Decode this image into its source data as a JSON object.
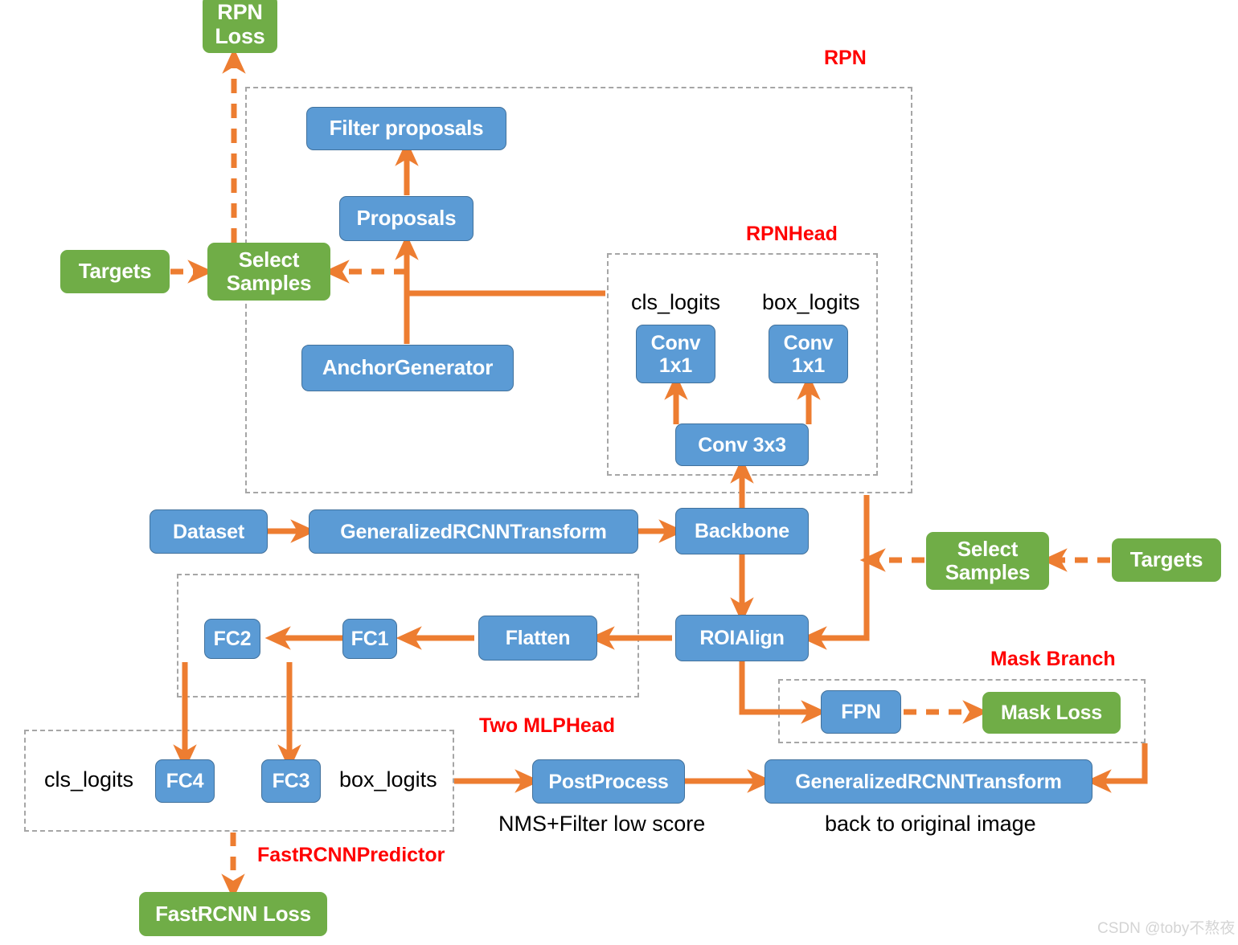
{
  "colors": {
    "blue_fill": "#5b9bd5",
    "blue_stroke": "#41719c",
    "green_fill": "#70ad47",
    "arrow_orange": "#ed7d31",
    "dash_gray": "#a6a6a6",
    "label_red": "#ff0000",
    "watermark_gray": "#d4d4d4"
  },
  "diagram": {
    "title": "Mask R-CNN / Faster R-CNN pipeline",
    "groups": [
      {
        "name": "RPN",
        "label": "RPN"
      },
      {
        "name": "RPNHead",
        "label": "RPNHead"
      },
      {
        "name": "TwoMLPHead",
        "label": "Two MLPHead"
      },
      {
        "name": "FastRCNNPredictor",
        "label": "FastRCNNPredictor"
      },
      {
        "name": "MaskBranch",
        "label": "Mask Branch"
      }
    ],
    "nodes": {
      "rpn_loss": "RPN\nLoss",
      "targets_left": "Targets",
      "select_samples_left": "Select\nSamples",
      "filter_proposals": "Filter proposals",
      "proposals": "Proposals",
      "anchor_generator": "AnchorGenerator",
      "conv1x1_cls": "Conv\n1x1",
      "conv1x1_box": "Conv\n1x1",
      "conv3x3": "Conv 3x3",
      "dataset": "Dataset",
      "transform_in": "GeneralizedRCNNTransform",
      "backbone": "Backbone",
      "select_samples_right": "Select\nSamples",
      "targets_right": "Targets",
      "roialign": "ROIAlign",
      "flatten": "Flatten",
      "fc1": "FC1",
      "fc2": "FC2",
      "fc4": "FC4",
      "fc3": "FC3",
      "fpn": "FPN",
      "mask_loss": "Mask Loss",
      "postprocess": "PostProcess",
      "transform_out": "GeneralizedRCNNTransform",
      "fastrcnn_loss": "FastRCNN Loss"
    },
    "annotations": {
      "cls_logits_rpn": "cls_logits",
      "box_logits_rpn": "box_logits",
      "cls_logits_head": "cls_logits",
      "box_logits_head": "box_logits",
      "nms_note": "NMS+Filter low score",
      "back_to_original": "back to original image"
    },
    "watermark": "CSDN @toby不熬夜"
  }
}
